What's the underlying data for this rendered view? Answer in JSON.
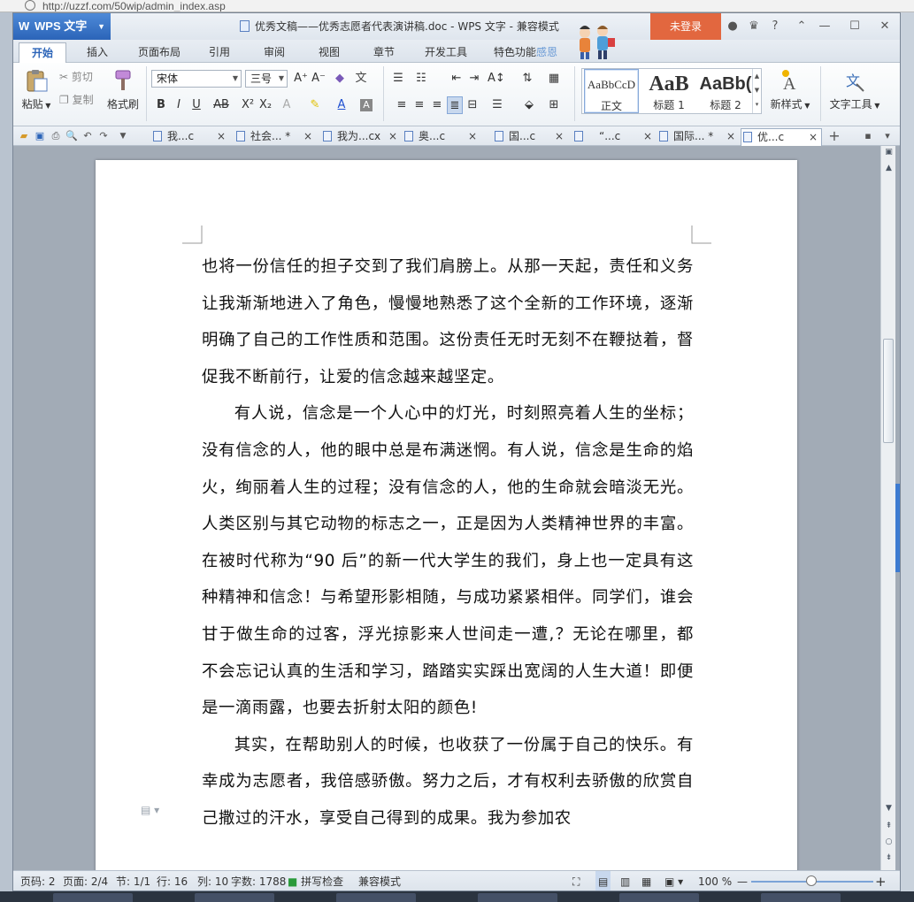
{
  "browser": {
    "url": "http://uzzf.com/50wip/admin_index.asp"
  },
  "app": {
    "name": "WPS 文字",
    "doc_title": "优秀文稿——优秀志愿者代表演讲稿.doc - WPS 文字 - 兼容模式",
    "login": "未登录"
  },
  "menu": [
    "开始",
    "插入",
    "页面布局",
    "引用",
    "审阅",
    "视图",
    "章节",
    "开发工具",
    "特色功能",
    "感恩"
  ],
  "ribbon": {
    "paste": "粘贴",
    "cut": "剪切",
    "copy": "复制",
    "format_painter": "格式刷",
    "font": "宋体",
    "font_size": "三号",
    "styles": [
      {
        "sample": "AaBbCcD",
        "label": "正文"
      },
      {
        "sample": "AaB",
        "label": "标题 1"
      },
      {
        "sample": "AaBb(",
        "label": "标题 2"
      }
    ],
    "new_style": "新样式",
    "text_tools": "文字工具"
  },
  "tabs": [
    {
      "label": "我...c",
      "close": "×"
    },
    {
      "label": "社会... *",
      "close": "×"
    },
    {
      "label": "我为...cx",
      "close": "×"
    },
    {
      "label": "奥...c",
      "close": "×"
    },
    {
      "label": "国...c",
      "close": "×"
    },
    {
      "label": "“...c",
      "close": "×"
    },
    {
      "label": "国际... *",
      "close": "×"
    },
    {
      "label": "优...c",
      "close": "×"
    }
  ],
  "document": {
    "paragraphs": [
      "也将一份信任的担子交到了我们肩膀上。从那一天起，责任和义务让我渐渐地进入了角色，慢慢地熟悉了这个全新的工作环境，逐渐明确了自己的工作性质和范围。这份责任无时无刻不在鞭挞着，督促我不断前行，让爱的信念越来越坚定。",
      "有人说，信念是一个人心中的灯光，时刻照亮着人生的坐标；没有信念的人，他的眼中总是布满迷惘。有人说，信念是生命的焰火，绚丽着人生的过程；没有信念的人，他的生命就会暗淡无光。人类区别与其它动物的标志之一，正是因为人类精神世界的丰富。在被时代称为“90 后”的新一代大学生的我们，身上也一定具有这种精神和信念！与希望形影相随，与成功紧紧相伴。同学们，谁会甘于做生命的过客，浮光掠影来人世间走一遭,？无论在哪里，都不会忘记认真的生活和学习，踏踏实实踩出宽阔的人生大道！即便是一滴雨露，也要去折射太阳的颜色!",
      "其实，在帮助别人的时候，也收获了一份属于自己的快乐。有幸成为志愿者，我倍感骄傲。努力之后，才有权利去骄傲的欣赏自己撒过的汗水，享受自己得到的成果。我为参加农"
    ]
  },
  "status": {
    "row": "页码: 2",
    "page": "页面: 2/4",
    "section": "节: 1/1",
    "line": "行: 16",
    "column": "列: 10",
    "words": "字数: 1788",
    "spell": "拼写检查",
    "mode": "兼容模式",
    "zoom": "100 %",
    "zoom_level": 0.5
  },
  "colors": {
    "accent": "#2b64b8",
    "login": "#e2673f"
  }
}
